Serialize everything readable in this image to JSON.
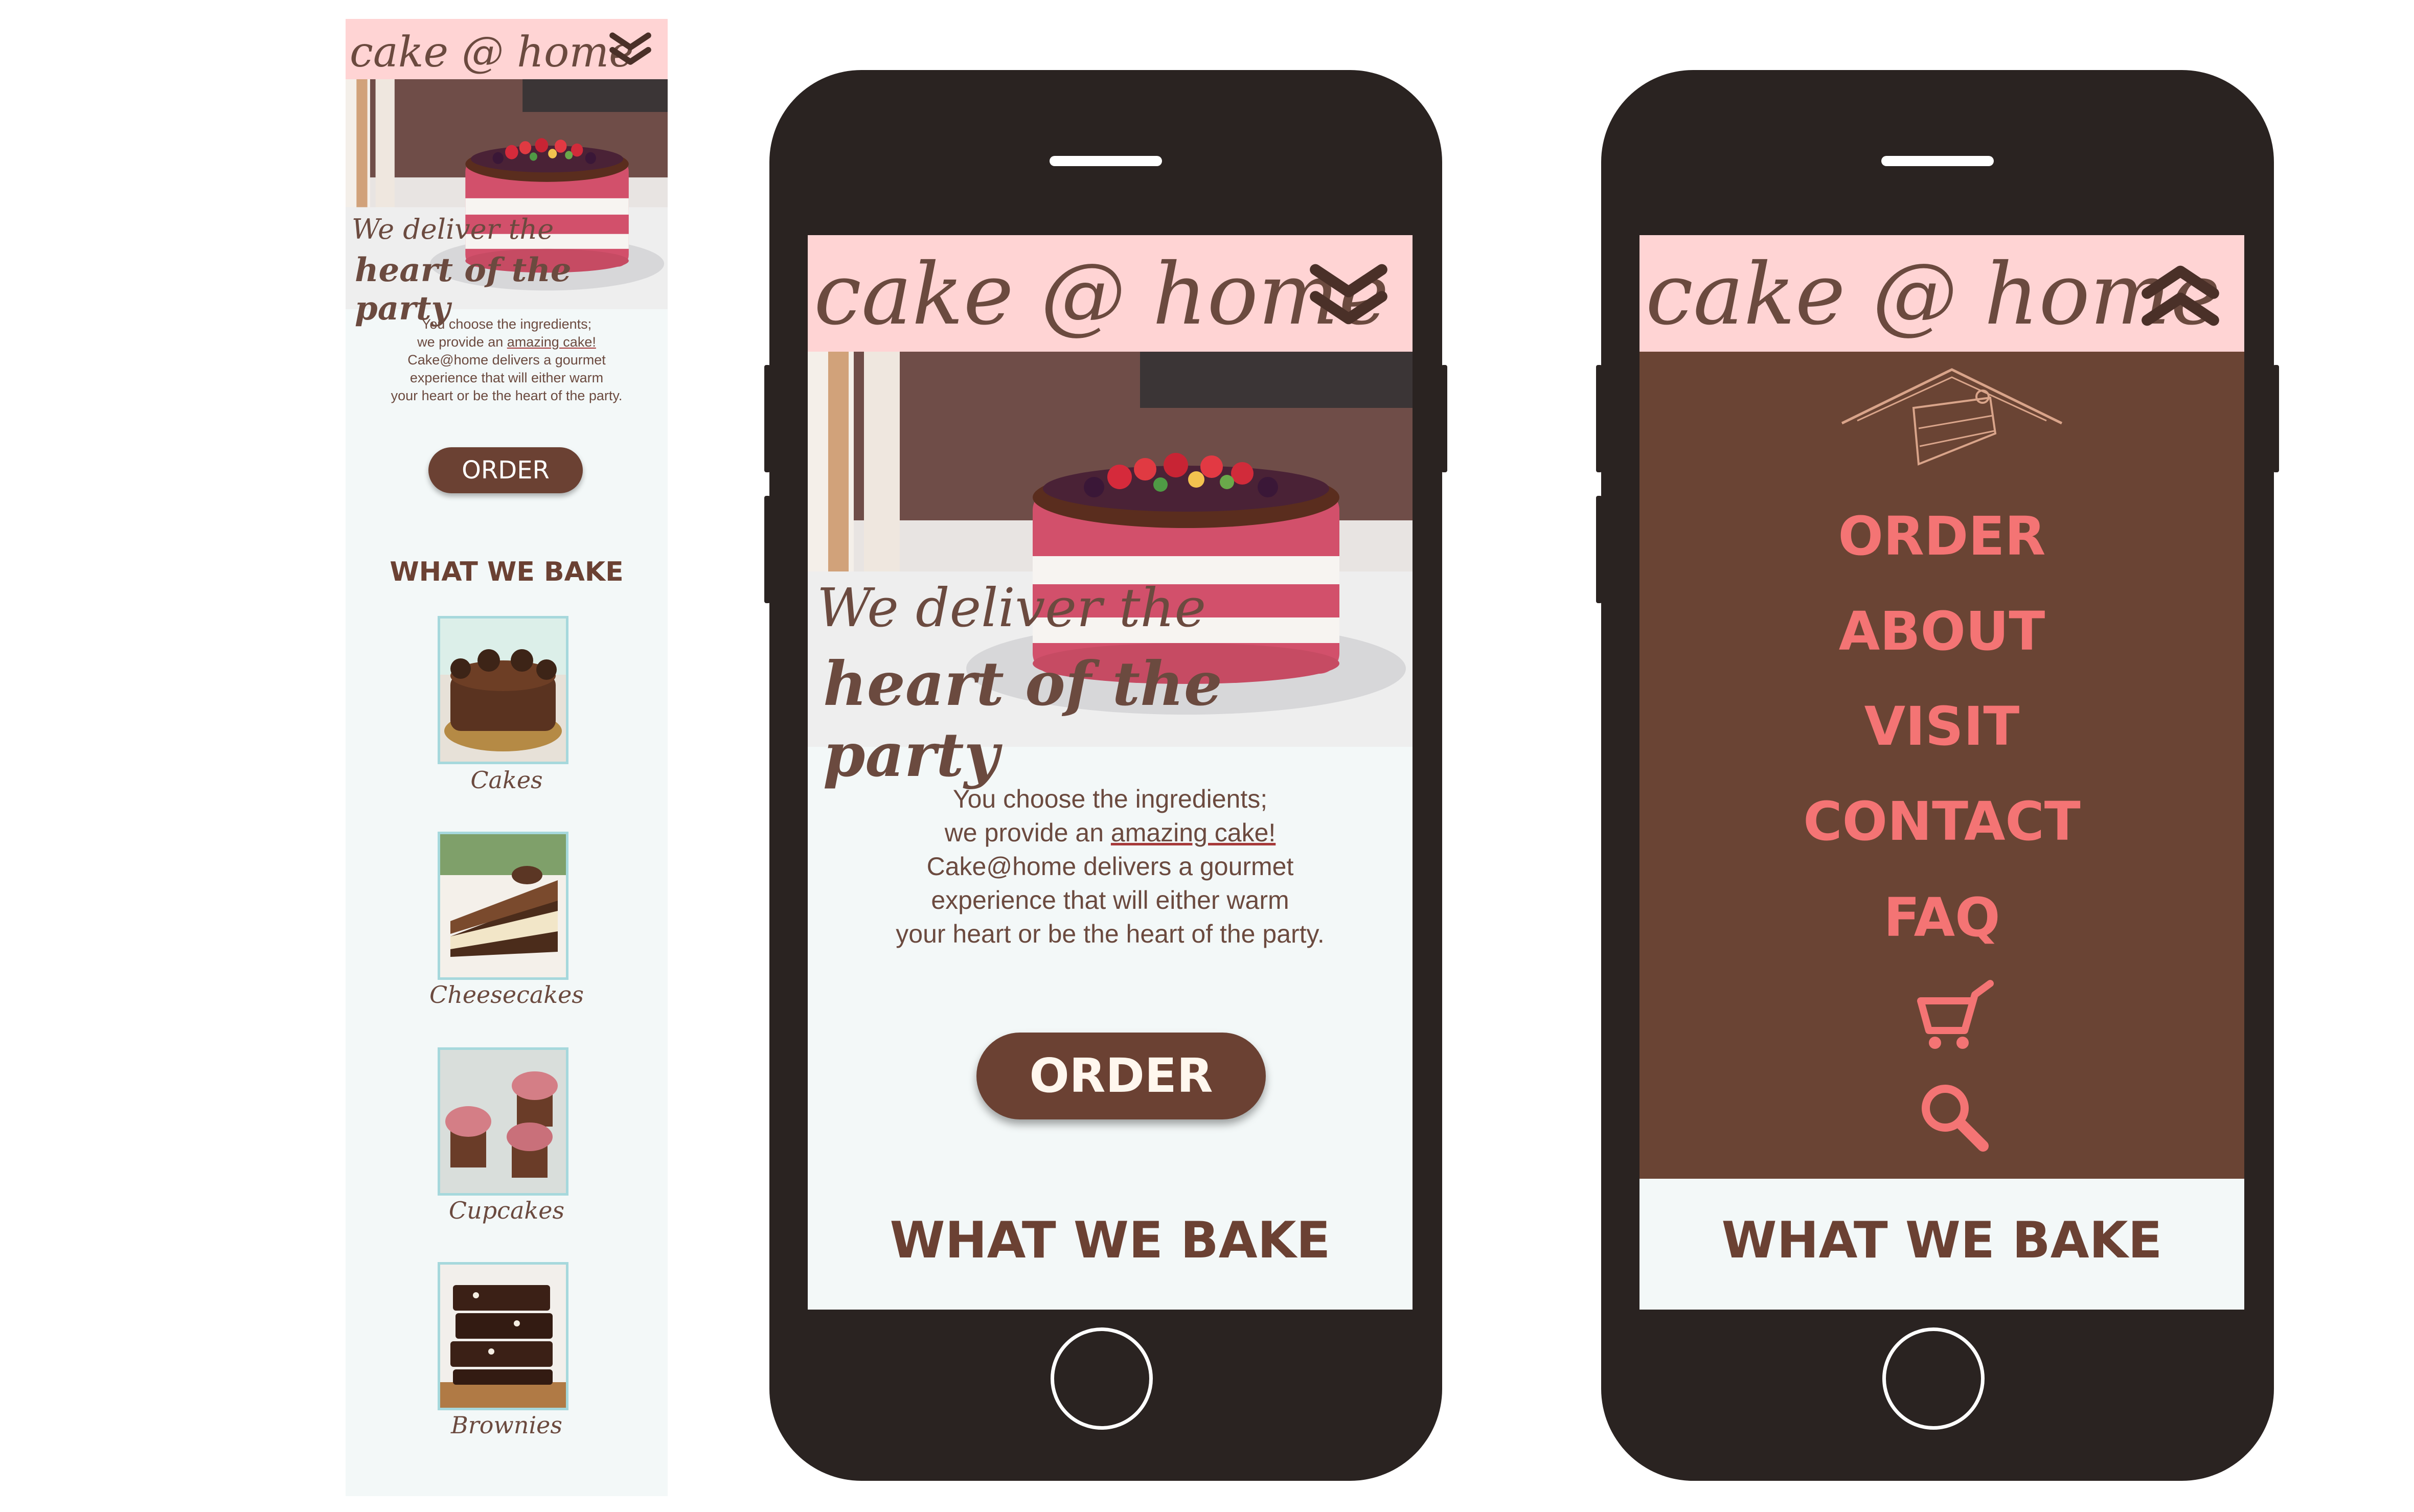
{
  "brand": {
    "logo": "cake @ home",
    "colors": {
      "header_pink": "#ffd4d4",
      "chocolate": "#6b4133",
      "menu_brown": "#6a4434",
      "menu_text": "#f47474",
      "page_bg": "#f3f8f8",
      "phone_body": "#2a2321"
    }
  },
  "hero": {
    "tagline_line1": "We deliver the",
    "tagline_line2": "heart of the party"
  },
  "intro": {
    "line1": "You choose the ingredients;",
    "line2_prefix": "we provide an ",
    "line2_link": "amazing cake!",
    "line3": "Cake@home delivers a gourmet",
    "line4": "experience that will either warm",
    "line5": "your heart or be the heart of the party."
  },
  "cta": {
    "order": "ORDER"
  },
  "section": {
    "what_we_bake": "WHAT WE BAKE"
  },
  "products": [
    {
      "label": "Cakes",
      "image": "chocolate-cake-photo"
    },
    {
      "label": "Cheesecakes",
      "image": "cheesecake-slice-photo"
    },
    {
      "label": "Cupcakes",
      "image": "cupcakes-photo"
    },
    {
      "label": "Brownies",
      "image": "brownie-stack-photo"
    }
  ],
  "menu": {
    "items": [
      "ORDER",
      "ABOUT",
      "VISIT",
      "CONTACT",
      "FAQ"
    ],
    "icons": [
      "cake-house-logo-icon",
      "cart-icon",
      "search-icon"
    ]
  },
  "icons": {
    "header_closed": "chevron-double-down-icon",
    "header_open": "chevron-double-up-icon",
    "hero": "naked-berry-cake-photo"
  }
}
